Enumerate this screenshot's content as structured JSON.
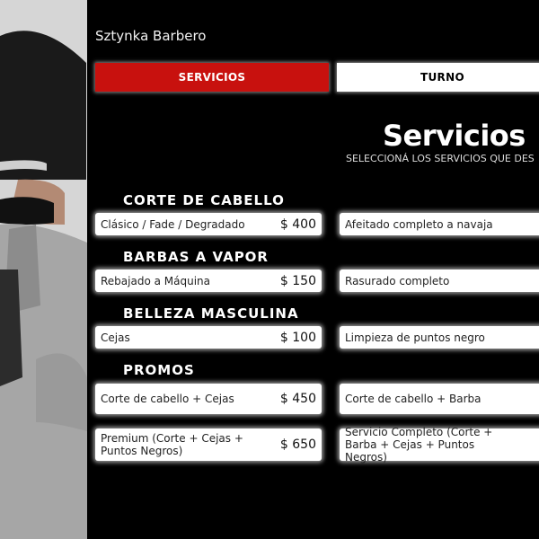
{
  "brand": "Sztynka Barbero",
  "tabs": {
    "servicios": "SERVICIOS",
    "turno": "TURNO"
  },
  "page": {
    "title": "Servicios",
    "subtitle": "SELECCIONÁ LOS SERVICIOS QUE DES"
  },
  "categories": {
    "corte": "CORTE DE CABELLO",
    "barbas": "BARBAS A VAPOR",
    "belleza": "BELLEZA MASCULINA",
    "promos": "PROMOS"
  },
  "services": {
    "corte_1": {
      "name": "Clásico / Fade / Degradado",
      "price": "$ 400"
    },
    "corte_2": {
      "name": "Afeitado completo a navaja",
      "price": "$"
    },
    "barbas_1": {
      "name": "Rebajado a Máquina",
      "price": "$ 150"
    },
    "barbas_2": {
      "name": "Rasurado completo",
      "price": "$"
    },
    "belleza_1": {
      "name": "Cejas",
      "price": "$ 100"
    },
    "belleza_2": {
      "name": "Limpieza de puntos negro",
      "price": "$"
    },
    "promo_1": {
      "name": "Corte de cabello + Cejas",
      "price": "$ 450"
    },
    "promo_2": {
      "name": "Corte de cabello + Barba",
      "price": "$"
    },
    "promo_3": {
      "name": "Premium (Corte + Cejas + Puntos Negros)",
      "price": "$ 650"
    },
    "promo_4": {
      "name": "Servicio Completo (Corte + Barba + Cejas + Puntos Negros)",
      "price": "$"
    }
  },
  "colors": {
    "accent": "#c8110e",
    "background": "#000000",
    "card": "#ffffff"
  }
}
